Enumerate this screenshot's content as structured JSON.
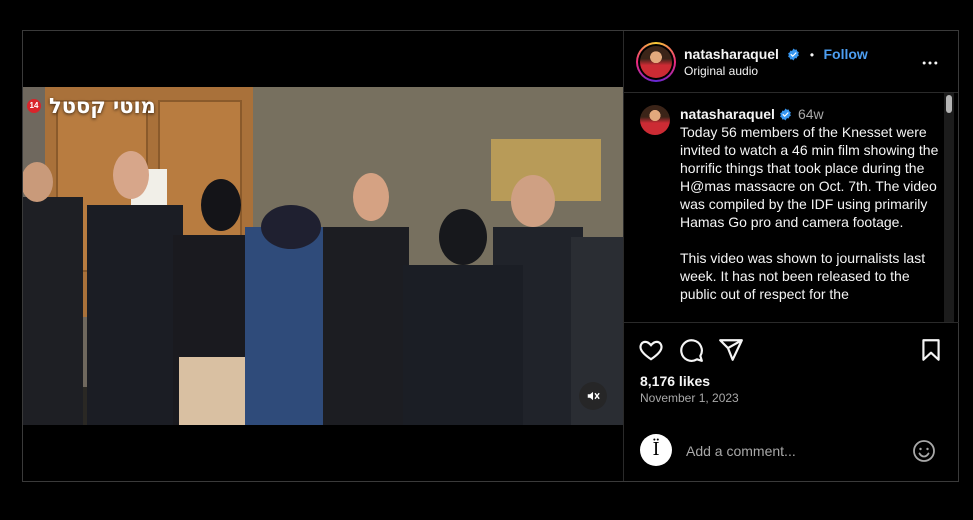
{
  "post": {
    "username": "natasharaquel",
    "follow_label": "Follow",
    "separator": "•",
    "audio_label": "Original audio",
    "caption_time": "64w",
    "caption_text": "Today 56 members of the Knesset were invited to watch a 46 min film showing the horrific things that took place during the H@mas massacre on Oct. 7th. The video was compiled by the IDF using primarily Hamas Go pro and camera footage.\n\nThis video was shown to journalists last week. It has not been released to the public out of respect for the",
    "likes": "8,176 likes",
    "date": "November 1, 2023"
  },
  "video": {
    "overlay_text": "מוטי קסטל",
    "channel_number": "14"
  },
  "comment": {
    "avatar_glyph": "Ï",
    "placeholder": "Add a comment..."
  },
  "icons": {
    "verified": "verified-badge-icon",
    "more": "more-options-icon",
    "like": "heart-icon",
    "comment": "comment-icon",
    "share": "share-icon",
    "save": "bookmark-icon",
    "mute": "speaker-muted-icon",
    "emoji": "emoji-icon"
  },
  "colors": {
    "background": "#000000",
    "accent": "#4d9ef0",
    "verified": "#3897f0",
    "text": "#f5f5f5",
    "muted_text": "#a8a8a8"
  }
}
